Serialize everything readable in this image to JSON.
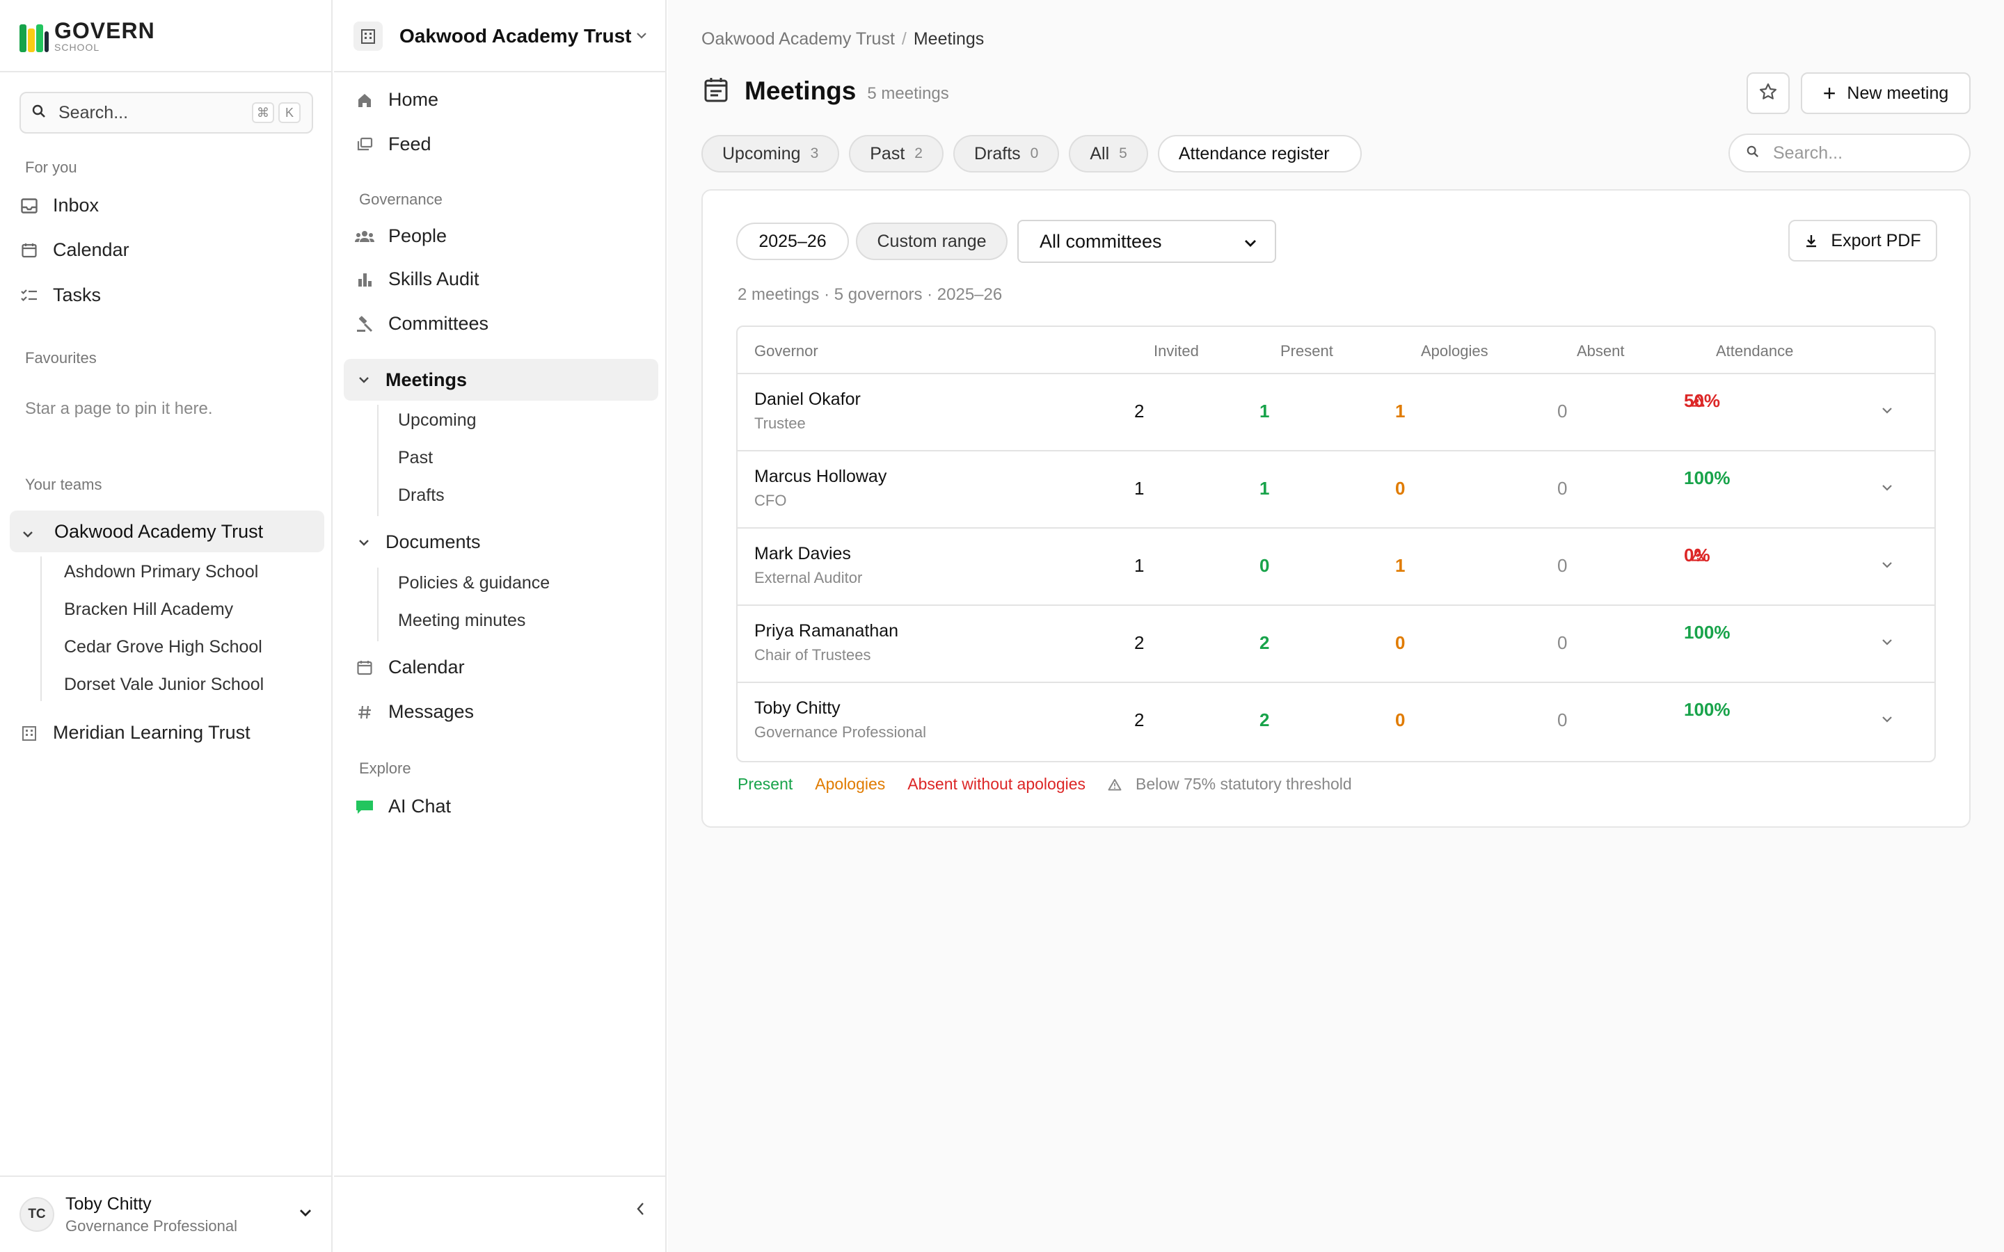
{
  "brand": {
    "name": "GOVERN",
    "sub": "SCHOOL",
    "bar_colors": [
      "#16a34a",
      "#facc15",
      "#22c55e",
      "#1f2937"
    ]
  },
  "sidebar": {
    "search_placeholder": "Search...",
    "shortcut_keys": [
      "⌘",
      "K"
    ],
    "for_you_label": "For you",
    "for_you": [
      {
        "label": "Inbox",
        "icon": "inbox-icon"
      },
      {
        "label": "Calendar",
        "icon": "calendar-icon"
      },
      {
        "label": "Tasks",
        "icon": "tasks-icon"
      }
    ],
    "favourites_label": "Favourites",
    "favourites_empty": "Star a page to pin it here.",
    "teams_label": "Your teams",
    "teams": [
      {
        "label": "Oakwood Academy Trust",
        "expanded": true,
        "children": [
          "Ashdown Primary School",
          "Bracken Hill Academy",
          "Cedar Grove High School",
          "Dorset Vale Junior School"
        ]
      },
      {
        "label": "Meridian Learning Trust",
        "expanded": false
      }
    ],
    "user": {
      "initials": "TC",
      "name": "Toby Chitty",
      "role": "Governance Professional"
    }
  },
  "nav": {
    "org": "Oakwood Academy Trust",
    "home": "Home",
    "feed": "Feed",
    "governance_label": "Governance",
    "people": "People",
    "skills_audit": "Skills Audit",
    "committees": "Committees",
    "meetings": "Meetings",
    "meetings_children": [
      "Upcoming",
      "Past",
      "Drafts"
    ],
    "documents": "Documents",
    "documents_children": [
      "Policies & guidance",
      "Meeting minutes"
    ],
    "calendar": "Calendar",
    "messages": "Messages",
    "explore_label": "Explore",
    "ai_chat": "AI Chat"
  },
  "page": {
    "breadcrumb": [
      "Oakwood Academy Trust",
      "Meetings"
    ],
    "title": "Meetings",
    "count": "5 meetings",
    "new_meeting": "New meeting",
    "tabs": [
      {
        "label": "Upcoming",
        "count": "3"
      },
      {
        "label": "Past",
        "count": "2"
      },
      {
        "label": "Drafts",
        "count": "0"
      },
      {
        "label": "All",
        "count": "5"
      },
      {
        "label": "Attendance register",
        "active": true
      }
    ],
    "search_placeholder": "Search..."
  },
  "register": {
    "year_chip": "2025–26",
    "custom_range": "Custom range",
    "committee_select": "All committees",
    "export": "Export PDF",
    "summary": "2 meetings · 5 governors · 2025–26",
    "columns": [
      "Governor",
      "Invited",
      "Present",
      "Apologies",
      "Absent",
      "Attendance"
    ],
    "rows": [
      {
        "name": "Daniel Okafor",
        "role": "Trustee",
        "invited": "2",
        "present": "1",
        "apologies": "1",
        "absent": "0",
        "attendance": "50%",
        "below_threshold": true
      },
      {
        "name": "Marcus Holloway",
        "role": "CFO",
        "invited": "1",
        "present": "1",
        "apologies": "0",
        "absent": "0",
        "attendance": "100%",
        "below_threshold": false
      },
      {
        "name": "Mark Davies",
        "role": "External Auditor",
        "invited": "1",
        "present": "0",
        "apologies": "1",
        "absent": "0",
        "attendance": "0%",
        "below_threshold": true
      },
      {
        "name": "Priya Ramanathan",
        "role": "Chair of Trustees",
        "invited": "2",
        "present": "2",
        "apologies": "0",
        "absent": "0",
        "attendance": "100%",
        "below_threshold": false
      },
      {
        "name": "Toby Chitty",
        "role": "Governance Professional",
        "invited": "2",
        "present": "2",
        "apologies": "0",
        "absent": "0",
        "attendance": "100%",
        "below_threshold": false
      }
    ],
    "legend": {
      "present": "Present",
      "apologies": "Apologies",
      "absent": "Absent without apologies",
      "threshold": "Below 75% statutory threshold"
    },
    "colors": {
      "present": "#18a34a",
      "apologies": "#e07b00",
      "absent": "#dc2626"
    }
  }
}
